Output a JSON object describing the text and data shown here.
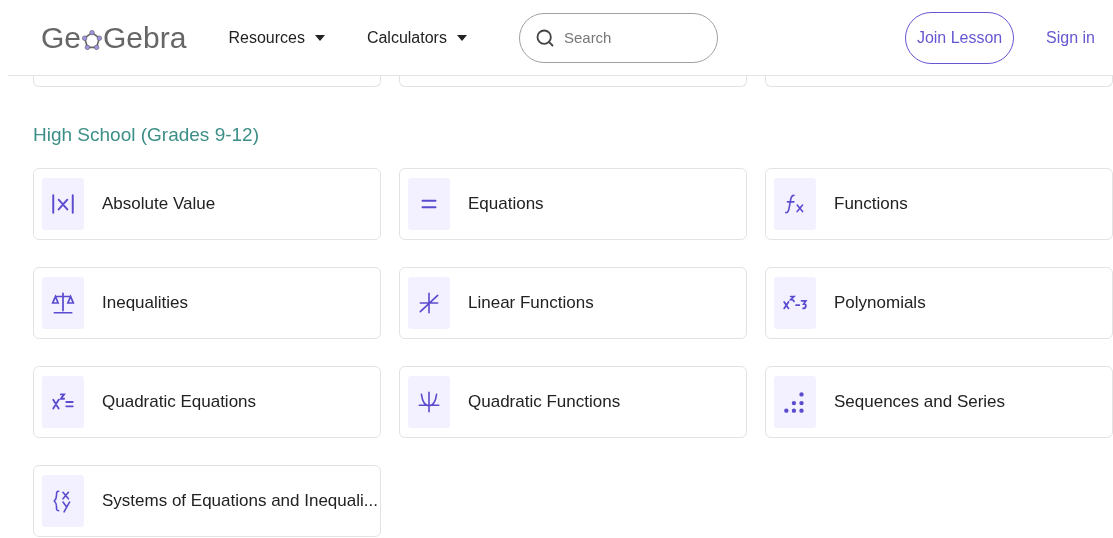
{
  "header": {
    "logo": {
      "before": "Ge",
      "after": "Gebra"
    },
    "nav": [
      {
        "label": "Resources"
      },
      {
        "label": "Calculators"
      }
    ],
    "search": {
      "placeholder": "Search"
    },
    "join_button": "Join Lesson",
    "sign_in": "Sign in"
  },
  "previous_row_cards": [
    {
      "kind": "partial-card"
    },
    {
      "kind": "partial-card"
    },
    {
      "kind": "partial-card"
    }
  ],
  "section": {
    "title": "High School (Grades 9-12)",
    "topics": [
      {
        "label": "Absolute Value",
        "kind": "absolute"
      },
      {
        "label": "Equations",
        "kind": "equals"
      },
      {
        "label": "Functions",
        "kind": "function"
      },
      {
        "label": "Inequalities",
        "kind": "scale"
      },
      {
        "label": "Linear Functions",
        "kind": "linear"
      },
      {
        "label": "Polynomials",
        "kind": "polynomial"
      },
      {
        "label": "Quadratic Equations",
        "kind": "quadratic"
      },
      {
        "label": "Quadratic Functions",
        "kind": "parabola"
      },
      {
        "label": "Sequences and Series",
        "kind": "dots"
      },
      {
        "label": "Systems of Equations and Inequali...",
        "kind": "system"
      }
    ]
  }
}
